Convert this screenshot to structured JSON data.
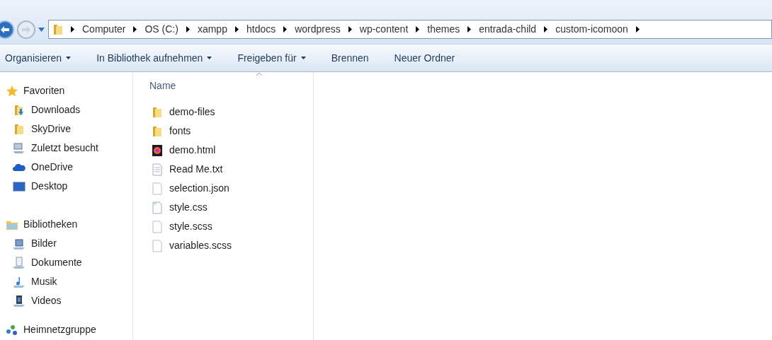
{
  "breadcrumb": [
    "Computer",
    "OS (C:)",
    "xampp",
    "htdocs",
    "wordpress",
    "wp-content",
    "themes",
    "entrada-child",
    "custom-icomoon"
  ],
  "toolbar": [
    {
      "label": "Organisieren",
      "dropdown": true
    },
    {
      "label": "In Bibliothek aufnehmen",
      "dropdown": true
    },
    {
      "label": "Freigeben für",
      "dropdown": true
    },
    {
      "label": "Brennen",
      "dropdown": false
    },
    {
      "label": "Neuer Ordner",
      "dropdown": false
    }
  ],
  "sidebar": [
    {
      "label": "Favoriten",
      "kind": "star",
      "children": [
        {
          "label": "Downloads",
          "kind": "downloads"
        },
        {
          "label": "SkyDrive",
          "kind": "folder"
        },
        {
          "label": "Zuletzt besucht",
          "kind": "recent"
        },
        {
          "label": "OneDrive",
          "kind": "cloud"
        },
        {
          "label": "Desktop",
          "kind": "desktop"
        }
      ]
    },
    {
      "label": "Bibliotheken",
      "kind": "library",
      "children": [
        {
          "label": "Bilder",
          "kind": "pictures"
        },
        {
          "label": "Dokumente",
          "kind": "documents"
        },
        {
          "label": "Musik",
          "kind": "music"
        },
        {
          "label": "Videos",
          "kind": "videos"
        }
      ]
    },
    {
      "label": "Heimnetzgruppe",
      "kind": "homegroup"
    }
  ],
  "column_header": "Name",
  "files": [
    {
      "name": "demo-files",
      "kind": "folder"
    },
    {
      "name": "fonts",
      "kind": "folder"
    },
    {
      "name": "demo.html",
      "kind": "browser"
    },
    {
      "name": "Read Me.txt",
      "kind": "text"
    },
    {
      "name": "selection.json",
      "kind": "file"
    },
    {
      "name": "style.css",
      "kind": "css"
    },
    {
      "name": "style.scss",
      "kind": "file"
    },
    {
      "name": "variables.scss",
      "kind": "file"
    }
  ]
}
